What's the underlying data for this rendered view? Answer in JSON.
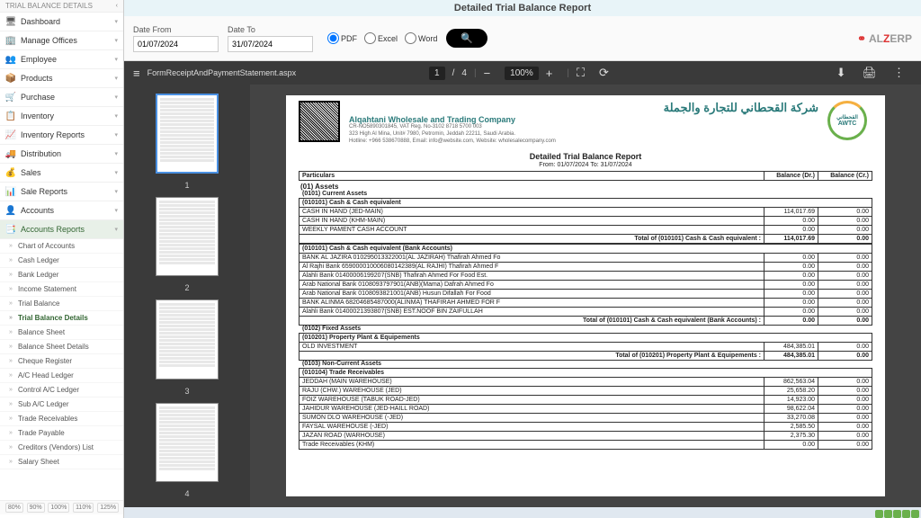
{
  "header": {
    "title": "Detailed Trial Balance Report"
  },
  "sidebar": {
    "section_title": "TRIAL BALANCE DETAILS",
    "main": [
      {
        "icon": "🖥",
        "label": "Dashboard"
      },
      {
        "icon": "🏢",
        "label": "Manage Offices"
      },
      {
        "icon": "👥",
        "label": "Employee"
      },
      {
        "icon": "📦",
        "label": "Products"
      },
      {
        "icon": "🛒",
        "label": "Purchase"
      },
      {
        "icon": "📋",
        "label": "Inventory"
      },
      {
        "icon": "📈",
        "label": "Inventory Reports"
      },
      {
        "icon": "🚚",
        "label": "Distribution"
      },
      {
        "icon": "💰",
        "label": "Sales"
      },
      {
        "icon": "📊",
        "label": "Sale Reports"
      },
      {
        "icon": "👤",
        "label": "Accounts"
      },
      {
        "icon": "📑",
        "label": "Accounts Reports"
      }
    ],
    "subs": [
      "Chart of Accounts",
      "Cash Ledger",
      "Bank Ledger",
      "Income Statement",
      "Trial Balance",
      "Trial Balance Details",
      "Balance Sheet",
      "Balance Sheet Details",
      "Cheque Register",
      "A/C Head Ledger",
      "Control A/C Ledger",
      "Sub A/C Ledger",
      "Trade Receivables",
      "Trade Payable",
      "Creditors (Vendors) List",
      "Salary Sheet"
    ],
    "zoom": [
      "80%",
      "90%",
      "100%",
      "110%",
      "125%"
    ]
  },
  "filter": {
    "from_label": "Date From",
    "from_value": "01/07/2024",
    "to_label": "Date To",
    "to_value": "31/07/2024",
    "pdf": "PDF",
    "excel": "Excel",
    "word": "Word",
    "brand_a": "AL",
    "brand_z": "Z",
    "brand_rest": "ERP"
  },
  "viewer": {
    "filename": "FormReceiptAndPaymentStatement.aspx",
    "page_current": "1",
    "page_sep": "/",
    "page_total": "4",
    "zoom": "100%",
    "thumb_labels": [
      "1",
      "2",
      "3",
      "4"
    ]
  },
  "report": {
    "arabic": "شركة القحطاني للتجارة والجملة",
    "english": "Alqahtani Wholesale and Trading Company",
    "meta1": "CR-NO5890301845, VAT Reg. No-3102 8718 5700 003",
    "meta2": "323 High Al Mina, Unit# 7980, Petromin, Jeddah 22211, Saudi Arabia.",
    "meta3": "Hotline: +966 538670888, Email: info@website.com, Website: wholesalecompany.com",
    "logo_top": "القحطاني",
    "logo_mid": "AWTC",
    "title": "Detailed Trial Balance Report",
    "range": "From: 01/07/2024   To: 31/07/2024",
    "th_particulars": "Particulars",
    "th_dr": "Balance (Dr.)",
    "th_cr": "Balance (Cr.)",
    "s01": "(01) Assets",
    "s0101": "(0101) Current Assets",
    "g_cash": "(010101) Cash & Cash equivalent",
    "cash_rows": [
      {
        "p": "CASH IN HAND (JED-MAIN)",
        "dr": "114,017.69",
        "cr": "0.00"
      },
      {
        "p": "CASH IN HAND (KHM-MAIN)",
        "dr": "0.00",
        "cr": "0.00"
      },
      {
        "p": "WEEKLY PAMENT CASH ACCOUNT",
        "dr": "0.00",
        "cr": "0.00"
      }
    ],
    "cash_total_label": "Total of (010101) Cash & Cash equivalent :",
    "cash_total_dr": "114,017.69",
    "cash_total_cr": "0.00",
    "g_bank": "(010101) Cash & Cash equivalent (Bank Accounts)",
    "bank_rows": [
      {
        "p": "BANK AL JAZIRA 010295013322001(AL JAZIRAH) Thafirah Ahmed Fo",
        "dr": "0.00",
        "cr": "0.00"
      },
      {
        "p": "Al Rajhi Bank 659000010006080142389(AL RAJHI) Thafirah Ahmed F",
        "dr": "0.00",
        "cr": "0.00"
      },
      {
        "p": "Alahli Bank 01400006199207(SNB) Thafirah Ahmed For Food Est.",
        "dr": "0.00",
        "cr": "0.00"
      },
      {
        "p": "Arab National Bank 0108093797901(ANB)(Mama) Dafrah Ahmed Fo",
        "dr": "0.00",
        "cr": "0.00"
      },
      {
        "p": "Arab National Bank 0108093821001(ANB) Husun Difallah For Food",
        "dr": "0.00",
        "cr": "0.00"
      },
      {
        "p": "BANK ALINMA 68204685487000(ALINMA) THAFIRAH AHMED FOR F",
        "dr": "0.00",
        "cr": "0.00"
      },
      {
        "p": "Alahli Bank 01400021393807(SNB) EST.NOOF BIN ZAIFULLAH",
        "dr": "0.00",
        "cr": "0.00"
      }
    ],
    "bank_total_label": "Total of (010101) Cash & Cash equivalent (Bank Accounts) :",
    "bank_total_dr": "0.00",
    "bank_total_cr": "0.00",
    "s0102": "(0102) Fixed Assets",
    "g_ppe": "(010201) Property Plant & Equipements",
    "ppe_rows": [
      {
        "p": "OLD INVESTMENT",
        "dr": "484,385.01",
        "cr": "0.00"
      }
    ],
    "ppe_total_label": "Total of (010201) Property Plant & Equipements :",
    "ppe_total_dr": "484,385.01",
    "ppe_total_cr": "0.00",
    "s0103": "(0103) Non-Current Assets",
    "g_tr": "(010104) Trade Receivables",
    "tr_rows": [
      {
        "p": "JEDDAH (MAIN WAREHOUSE)",
        "dr": "862,563.04",
        "cr": "0.00"
      },
      {
        "p": "RAJU (CHW.) WAREHOUSE (JED)",
        "dr": "25,658.20",
        "cr": "0.00"
      },
      {
        "p": "FOIZ WAREHOUSE (TABUK ROAD-JED)",
        "dr": "14,923.00",
        "cr": "0.00"
      },
      {
        "p": "JAHIDUR WAREHOUSE (JED-HAILL ROAD)",
        "dr": "98,622.04",
        "cr": "0.00"
      },
      {
        "p": "SUMON DLO WAREHOUSE (-JED)",
        "dr": "33,270.08",
        "cr": "0.00"
      },
      {
        "p": "FAYSAL WAREHOUSE (-JED)",
        "dr": "2,585.50",
        "cr": "0.00"
      },
      {
        "p": "JAZAN ROAD (WARHOUSE)",
        "dr": "2,375.30",
        "cr": "0.00"
      },
      {
        "p": "Trade Receivables (KHM)",
        "dr": "0.00",
        "cr": "0.00"
      }
    ]
  }
}
